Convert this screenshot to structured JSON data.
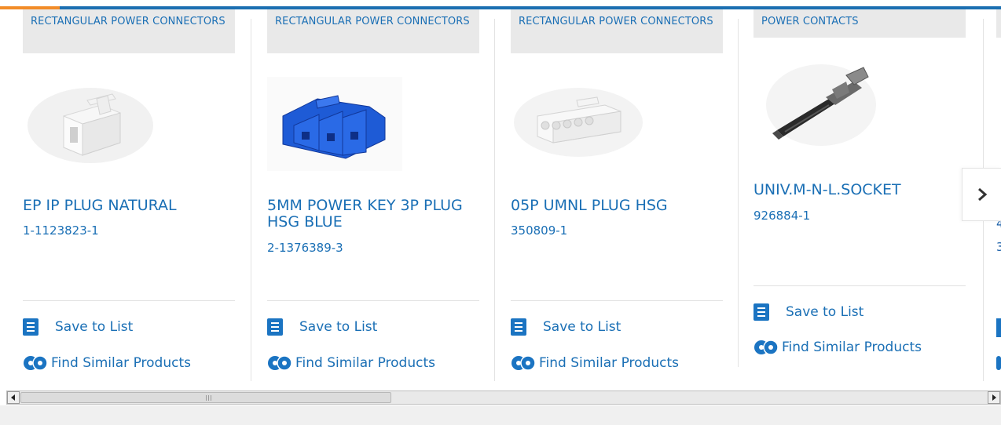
{
  "colors": {
    "accent_blue": "#1b6fb1",
    "accent_orange": "#f28c28",
    "link": "#1a6fb5",
    "category_bg": "#e9e9e9"
  },
  "products": [
    {
      "category": "RECTANGULAR POWER CONNECTORS",
      "title": "EP IP PLUG NATURAL",
      "part_number": "1-1123823-1",
      "image": "white-plug-connector"
    },
    {
      "category": "RECTANGULAR POWER CONNECTORS",
      "title": "5MM POWER KEY 3P PLUG HSG BLUE",
      "part_number": "2-1376389-3",
      "image": "blue-3-position-connector"
    },
    {
      "category": "RECTANGULAR POWER CONNECTORS",
      "title": "05P UMNL PLUG HSG",
      "part_number": "350809-1",
      "image": "white-5-position-housing"
    },
    {
      "category": "POWER CONTACTS",
      "title": "UNIV.M-N-L.SOCKET",
      "part_number": "926884-1",
      "image": "metal-socket-contact"
    }
  ],
  "actions": {
    "save_label": "Save to List",
    "similar_label": "Find Similar Products"
  },
  "partial_card": {
    "title_fragment": "4",
    "pn_fragment": "3"
  },
  "carousel": {
    "next_icon": "chevron-right-icon"
  }
}
